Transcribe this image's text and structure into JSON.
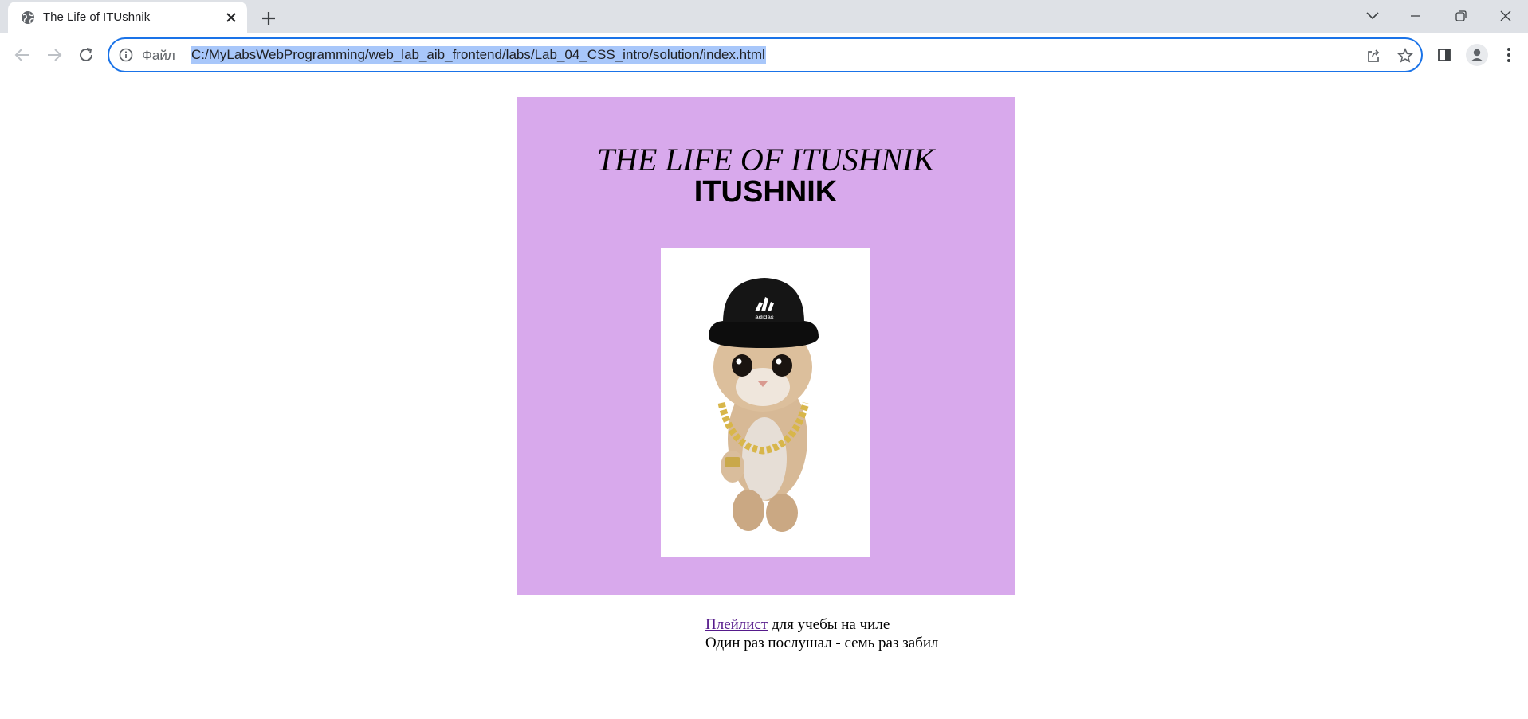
{
  "browser": {
    "tab": {
      "title": "The Life of ITUshnik",
      "favicon": "globe-icon"
    },
    "new_tab_icon": "plus-icon",
    "window_controls": [
      "chevron-down-icon",
      "minimize-icon",
      "restore-icon",
      "close-icon"
    ],
    "omnibox": {
      "scheme_label": "Файл",
      "url": "C:/MyLabsWebProgramming/web_lab_aib_frontend/labs/Lab_04_CSS_intro/solution/index.html"
    },
    "colors": {
      "tabstrip": "#dee1e6",
      "focus_ring": "#1a73e8",
      "selection": "#a8c7fa"
    }
  },
  "page": {
    "card_color": "#d8a9ec",
    "title_line1": "THE LIFE OF ITUSHNIK",
    "title_line2": "ITUSHNIK",
    "image_description_icon": "cat-in-bucket-hat-with-gold-chain",
    "link_text": "Плейлист",
    "line1_rest": " для учебы на чиле",
    "line2": "Один раз послушал - семь раз забил",
    "link_color": "#551a8b"
  }
}
